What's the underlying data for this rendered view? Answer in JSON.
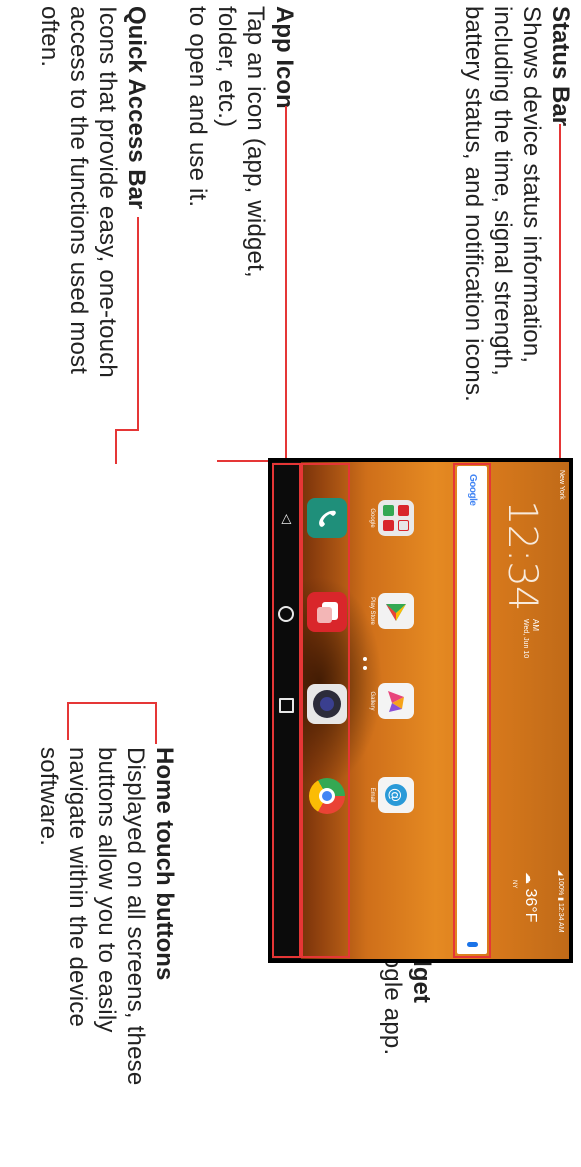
{
  "callouts": {
    "status_bar": {
      "title": "Status Bar",
      "desc": [
        "Shows device status information,",
        "including the time, signal strength,",
        "battery status, and notification icons."
      ]
    },
    "app_icon": {
      "title": "App Icon",
      "desc": [
        "Tap an icon (app, widget, folder, etc.)",
        "to open and use it."
      ]
    },
    "quick_access": {
      "title": "Quick Access Bar",
      "desc": [
        "Icons that provide easy, one-touch",
        "access to the functions used most",
        "often."
      ]
    },
    "google_search": {
      "title": "Google Search Widget",
      "desc": [
        "Tap to open the Google app."
      ]
    },
    "home_touch": {
      "title": "Home touch buttons",
      "desc": [
        "Displayed on all screens, these",
        "buttons allow you to easily",
        "navigate within the device",
        "software."
      ]
    }
  },
  "phone": {
    "status_left": "New York",
    "status_right": "◢ 100% ▮ 12:34 AM",
    "clock_time": "12:34",
    "clock_ampm": "AM",
    "clock_date": "Wed, Jun 10",
    "weather_temp": "36°F",
    "weather_loc": "NY",
    "search_logo": "Google",
    "apps": [
      {
        "label": "Google",
        "color": "#e9e9e9"
      },
      {
        "label": "Play Store",
        "color": "#f2f2f2"
      },
      {
        "label": "Gallery",
        "color": "#f4f4f4"
      },
      {
        "label": "Email",
        "color": "#f4f4f4"
      }
    ],
    "quick_access": [
      {
        "name": "phone",
        "color": "#1f8f7a"
      },
      {
        "name": "messaging",
        "color": "#d9262b"
      },
      {
        "name": "camera",
        "color": "#e7e7e7"
      },
      {
        "name": "chrome",
        "color": "#dfe7df"
      }
    ],
    "nav": [
      "back",
      "home",
      "recent"
    ],
    "accent": "#e53636"
  }
}
